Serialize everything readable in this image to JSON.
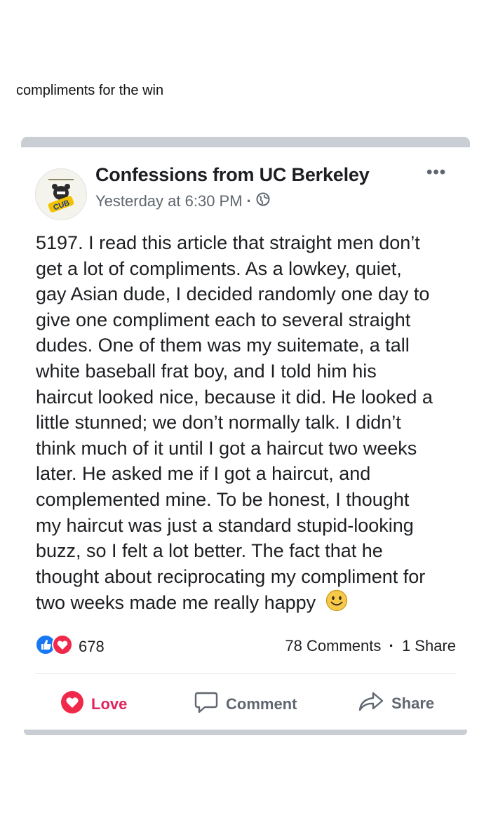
{
  "caption": "compliments for the win",
  "post": {
    "page_name": "Confessions from UC Berkeley",
    "timestamp": "Yesterday at 6:30 PM",
    "avatar_text": "CUB",
    "more_icon": "more-dots-icon",
    "lines": [
      "5197. I read this article that straight men don’t",
      "get a lot of compliments. As a lowkey, quiet,",
      "gay Asian dude, I decided randomly one day to",
      "give one compliment each to several straight",
      "dudes. One of them was my suitemate, a tall",
      "white baseball frat boy, and I told him his",
      "haircut looked nice, because it did. He looked a",
      "little stunned; we don’t normally talk. I didn’t",
      "think much of it until I got a haircut two weeks",
      "later. He asked me if I got a haircut, and",
      "complemented mine. To be honest, I thought",
      "my haircut was just a standard stupid-looking",
      "buzz, so I felt a lot better. The fact that he",
      "thought about reciprocating my compliment for",
      "two weeks made me really happy"
    ]
  },
  "engagement": {
    "reaction_count": "678",
    "comments": "78 Comments",
    "shares": "1 Share"
  },
  "actions": {
    "love": "Love",
    "comment": "Comment",
    "share": "Share"
  },
  "colors": {
    "like_blue": "#1877f2",
    "love_red": "#e0245e",
    "frame_gray": "#c9ced4",
    "text_gray": "#606770"
  }
}
